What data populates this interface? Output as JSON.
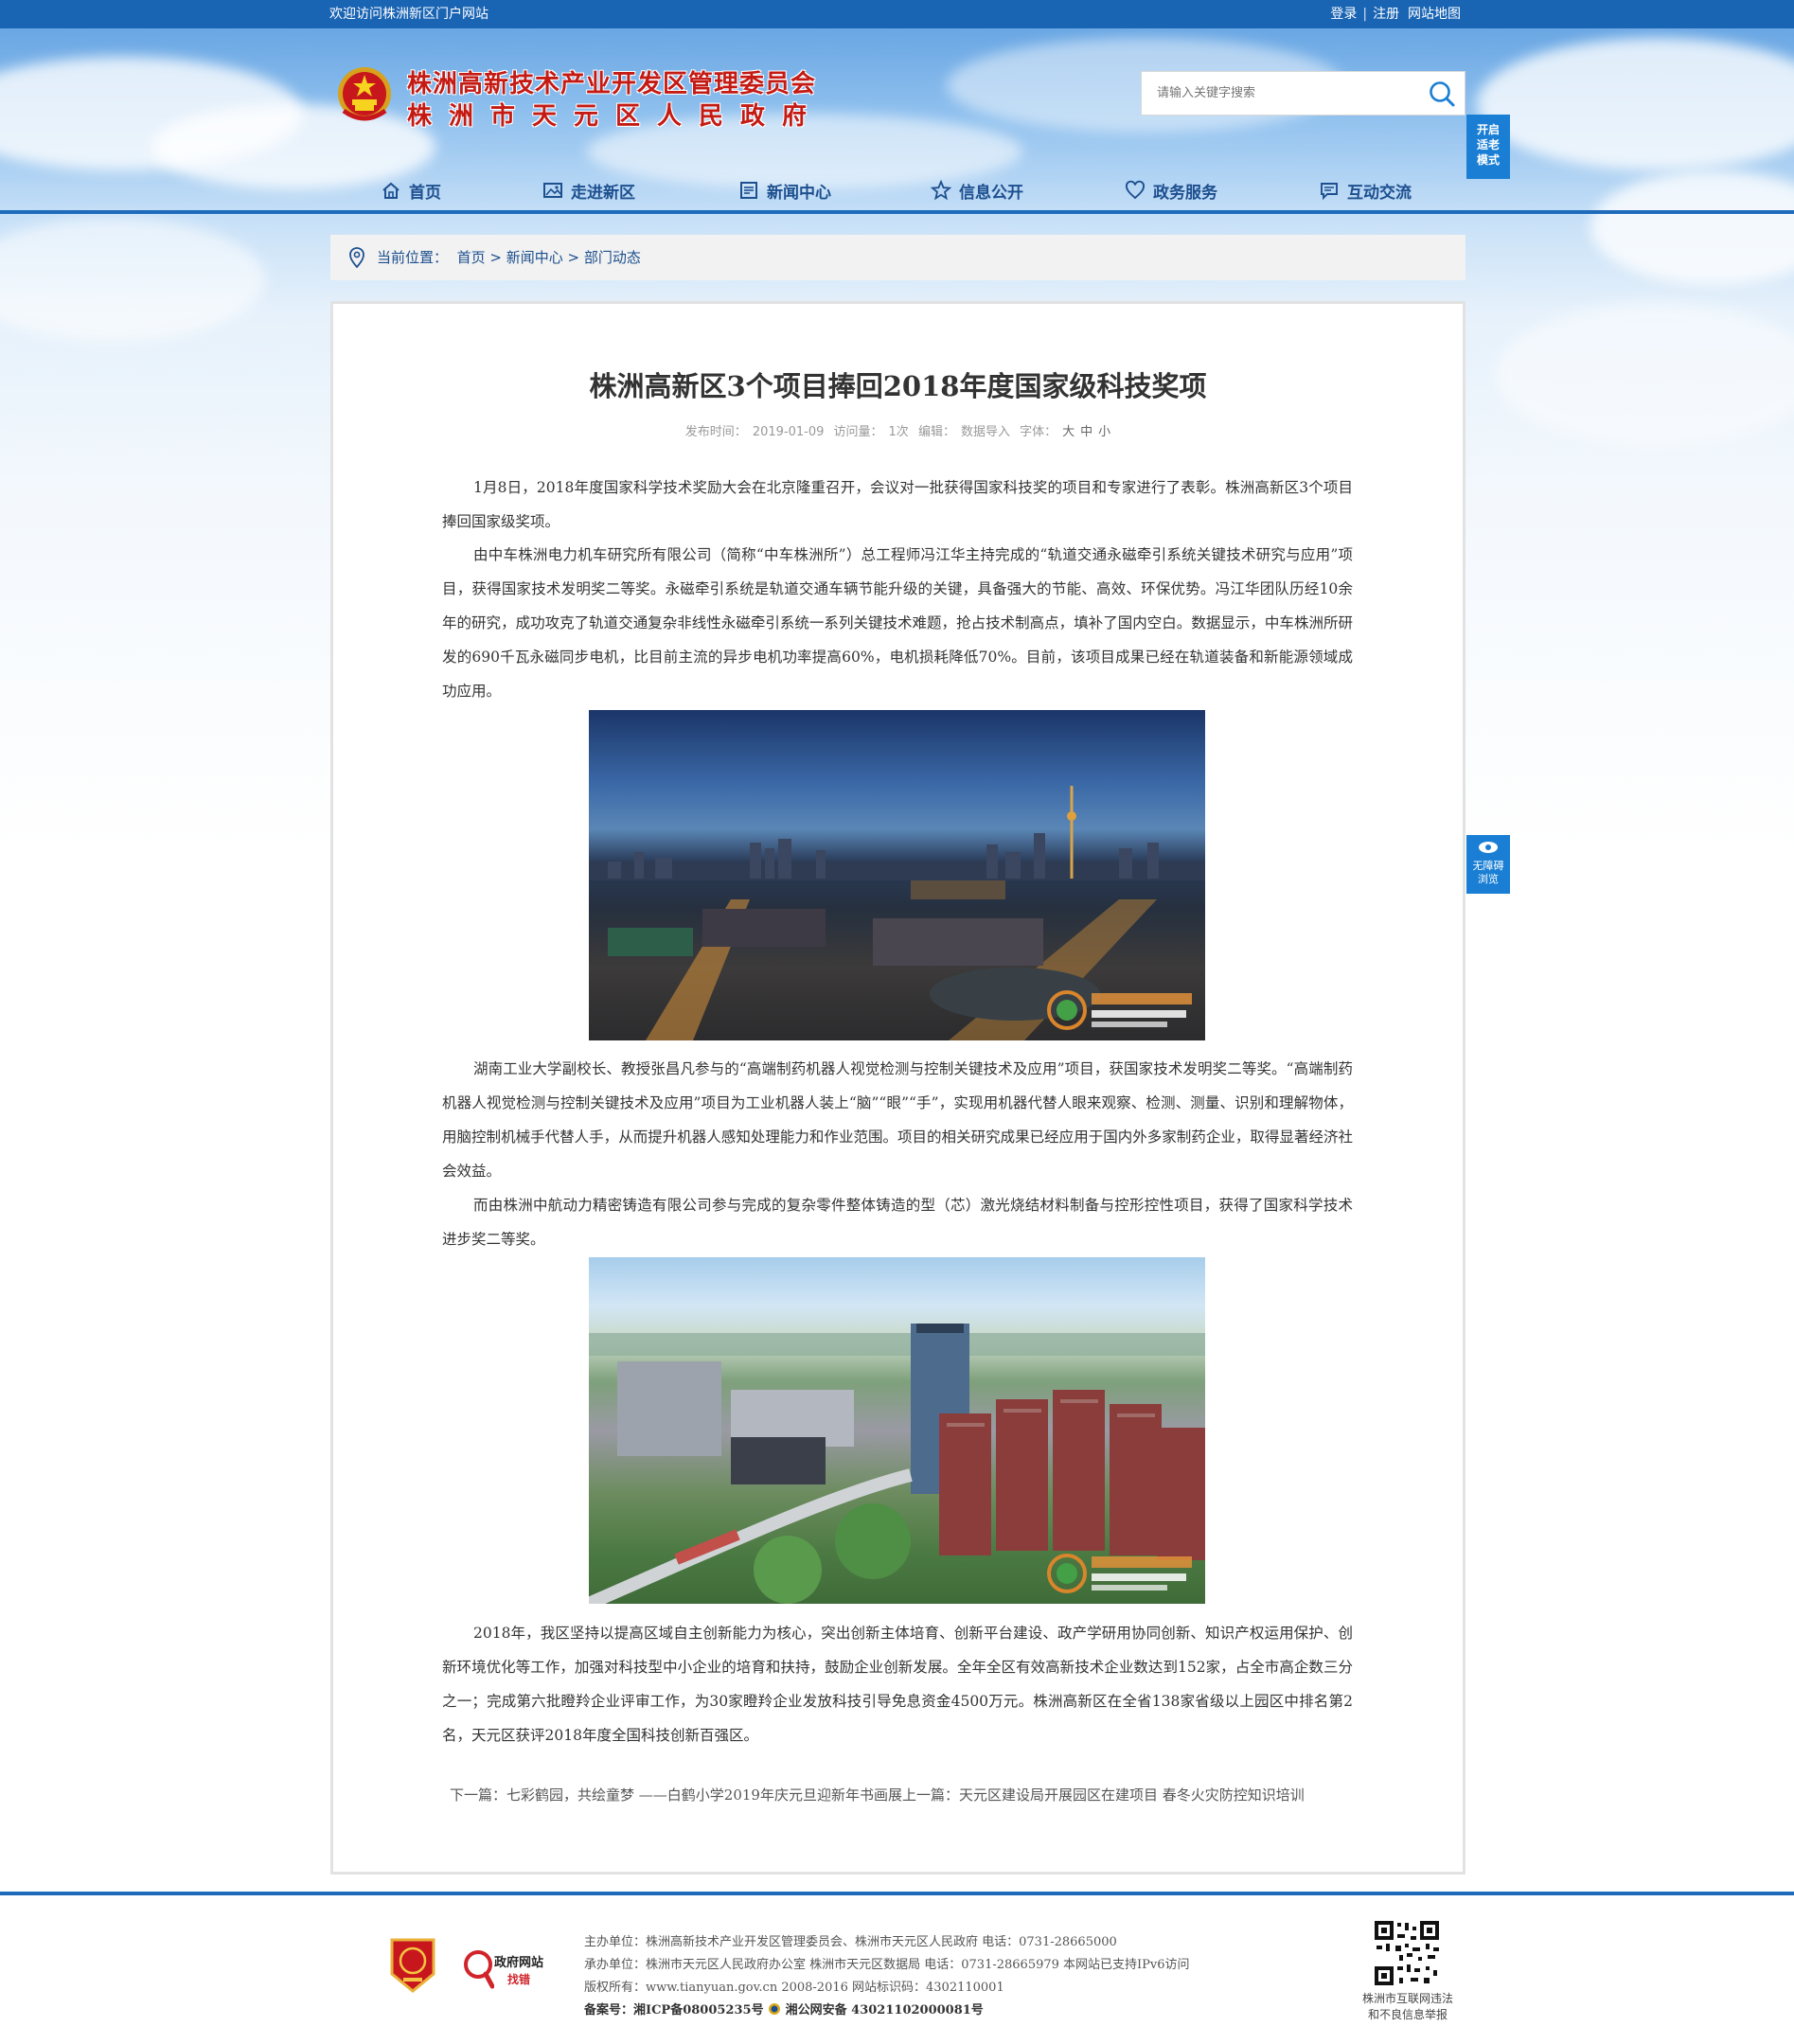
{
  "topbar": {
    "welcome": "欢迎访问株洲新区门户网站",
    "login": "登录",
    "separator": "|",
    "register": "注册",
    "sitemap": "网站地图"
  },
  "header": {
    "title_line1": "株洲高新技术产业开发区管理委员会",
    "title_line2": "株洲市天元区人民政府",
    "search_placeholder": "请输入关键字搜索",
    "elder_mode": "开启适老模式",
    "accessibility": "无障碍浏览"
  },
  "nav": {
    "items": [
      {
        "label": "首页",
        "icon": "home-icon"
      },
      {
        "label": "走进新区",
        "icon": "picture-icon"
      },
      {
        "label": "新闻中心",
        "icon": "news-icon"
      },
      {
        "label": "信息公开",
        "icon": "star-icon"
      },
      {
        "label": "政务服务",
        "icon": "heart-icon"
      },
      {
        "label": "互动交流",
        "icon": "chat-icon"
      }
    ]
  },
  "breadcrumb": {
    "prefix": "当前位置：",
    "items": [
      "首页",
      "新闻中心",
      "部门动态"
    ],
    "separator": ">"
  },
  "article": {
    "title": "株洲高新区3个项目捧回2018年度国家级科技奖项",
    "meta": {
      "published_label": "发布时间：",
      "published": "2019-01-09",
      "visits_label": "访问量：",
      "visits": "1次",
      "editor_label": "编辑：",
      "editor": "数据导入",
      "font_label": "字体：",
      "font_large": "大",
      "font_medium": "中",
      "font_small": "小"
    },
    "paragraphs": [
      "1月8日，2018年度国家科学技术奖励大会在北京隆重召开，会议对一批获得国家科技奖的项目和专家进行了表彰。株洲高新区3个项目捧回国家级奖项。",
      "由中车株洲电力机车研究所有限公司（简称“中车株洲所”）总工程师冯江华主持完成的“轨道交通永磁牵引系统关键技术研究与应用”项目，获得国家技术发明奖二等奖。永磁牵引系统是轨道交通车辆节能升级的关键，具备强大的节能、高效、环保优势。冯江华团队历经10余年的研究，成功攻克了轨道交通复杂非线性永磁牵引系统一系列关键技术难题，抢占技术制高点，填补了国内空白。数据显示，中车株洲所研发的690千瓦永磁同步电机，比目前主流的异步电机功率提高60%，电机损耗降低70%。目前，该项目成果已经在轨道装备和新能源领域成功应用。",
      "湖南工业大学副校长、教授张昌凡参与的“高端制药机器人视觉检测与控制关键技术及应用”项目，获国家技术发明奖二等奖。“高端制药机器人视觉检测与控制关键技术及应用”项目为工业机器人装上“脑”“眼”“手”，实现用机器代替人眼来观察、检测、测量、识别和理解物体，用脑控制机械手代替人手，从而提升机器人感知处理能力和作业范围。项目的相关研究成果已经应用于国内外多家制药企业，取得显著经济社会效益。",
      "而由株洲中航动力精密铸造有限公司参与完成的复杂零件整体铸造的型（芯）激光烧结材料制备与控形控性项目，获得了国家科学技术进步奖二等奖。",
      "2018年，我区坚持以提高区域自主创新能力为核心，突出创新主体培育、创新平台建设、政产学研用协同创新、知识产权运用保护、创新环境优化等工作，加强对科技型中小企业的培育和扶持，鼓励企业创新发展。全年全区有效高新技术企业数达到152家，占全市高企数三分之一；完成第六批瞪羚企业评审工作，为30家瞪羚企业发放科技引导免息资金4500万元。株洲高新区在全省138家省级以上园区中排名第2名，天元区获评2018年度全国科技创新百强区。"
    ],
    "prevnext": "下一篇：七彩鹤园，共绘童梦 ——白鹤小学2019年庆元旦迎新年书画展上一篇：天元区建设局开展园区在建项目 春冬火灾防控知识培训"
  },
  "footer": {
    "host": "主办单位：株洲高新技术产业开发区管理委员会、株洲市天元区人民政府 电话：0731-28665000",
    "organizer": "承办单位：株洲市天元区人民政府办公室 株洲市天元区数据局 电话：0731-28665979 本网站已支持IPv6访问",
    "copyright": "版权所有：www.tianyuan.gov.cn 2008-2016 网站标识码：4302110001",
    "icp": "备案号：湘ICP备08005235号",
    "police": "湘公网安备 43021102000081号",
    "gov_badge_line1": "政府网站",
    "gov_badge_line2": "找错",
    "qr_label_line1": "株洲市互联网违法",
    "qr_label_line2": "和不良信息举报"
  },
  "colors": {
    "brand_blue": "#1a64b4",
    "title_red": "#c41a14",
    "nav_text": "#1d4f8f"
  }
}
